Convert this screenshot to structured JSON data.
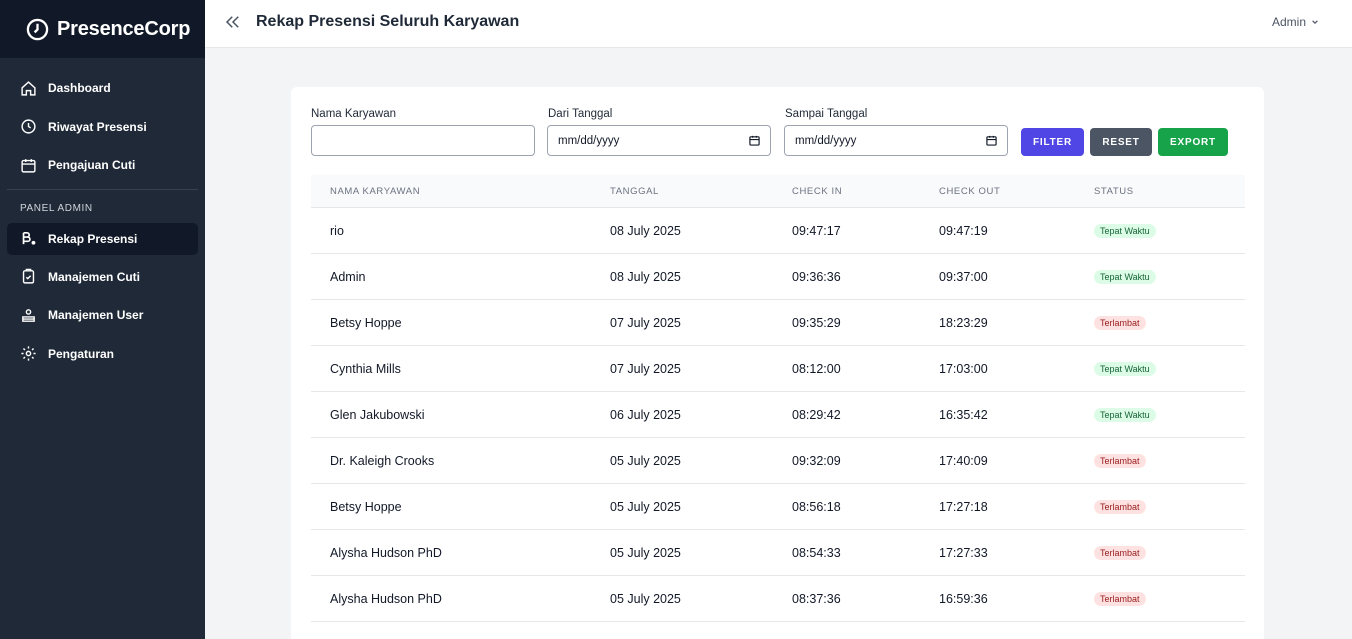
{
  "brand": {
    "name": "PresenceCorp"
  },
  "sidebar": {
    "items": [
      {
        "label": "Dashboard",
        "icon": "home-icon"
      },
      {
        "label": "Riwayat Presensi",
        "icon": "clock-icon"
      },
      {
        "label": "Pengajuan Cuti",
        "icon": "calendar-icon"
      }
    ],
    "section_label": "PANEL ADMIN",
    "admin_items": [
      {
        "label": "Rekap Presensi",
        "icon": "chart-icon",
        "active": true
      },
      {
        "label": "Manajemen Cuti",
        "icon": "clipboard-icon"
      },
      {
        "label": "Manajemen User",
        "icon": "users-icon"
      },
      {
        "label": "Pengaturan",
        "icon": "gear-icon"
      }
    ]
  },
  "header": {
    "title": "Rekap Presensi Seluruh Karyawan",
    "user": "Admin"
  },
  "filters": {
    "name_label": "Nama Karyawan",
    "name_value": "",
    "from_label": "Dari Tanggal",
    "from_value": "mm/dd/yyyy",
    "to_label": "Sampai Tanggal",
    "to_value": "mm/dd/yyyy",
    "filter_button": "FILTER",
    "reset_button": "RESET",
    "export_button": "EXPORT"
  },
  "table": {
    "columns": [
      "NAMA KARYAWAN",
      "TANGGAL",
      "CHECK IN",
      "CHECK OUT",
      "STATUS"
    ],
    "rows": [
      {
        "name": "rio",
        "date": "08 July 2025",
        "in": "09:47:17",
        "out": "09:47:19",
        "status": "Tepat Waktu"
      },
      {
        "name": "Admin",
        "date": "08 July 2025",
        "in": "09:36:36",
        "out": "09:37:00",
        "status": "Tepat Waktu"
      },
      {
        "name": "Betsy Hoppe",
        "date": "07 July 2025",
        "in": "09:35:29",
        "out": "18:23:29",
        "status": "Terlambat"
      },
      {
        "name": "Cynthia Mills",
        "date": "07 July 2025",
        "in": "08:12:00",
        "out": "17:03:00",
        "status": "Tepat Waktu"
      },
      {
        "name": "Glen Jakubowski",
        "date": "06 July 2025",
        "in": "08:29:42",
        "out": "16:35:42",
        "status": "Tepat Waktu"
      },
      {
        "name": "Dr. Kaleigh Crooks",
        "date": "05 July 2025",
        "in": "09:32:09",
        "out": "17:40:09",
        "status": "Terlambat"
      },
      {
        "name": "Betsy Hoppe",
        "date": "05 July 2025",
        "in": "08:56:18",
        "out": "17:27:18",
        "status": "Terlambat"
      },
      {
        "name": "Alysha Hudson PhD",
        "date": "05 July 2025",
        "in": "08:54:33",
        "out": "17:27:33",
        "status": "Terlambat"
      },
      {
        "name": "Alysha Hudson PhD",
        "date": "05 July 2025",
        "in": "08:37:36",
        "out": "16:59:36",
        "status": "Terlambat"
      }
    ]
  },
  "colors": {
    "ok_bg": "#dcfce7",
    "late_bg": "#fee2e2",
    "accent": "#4f46e5"
  }
}
